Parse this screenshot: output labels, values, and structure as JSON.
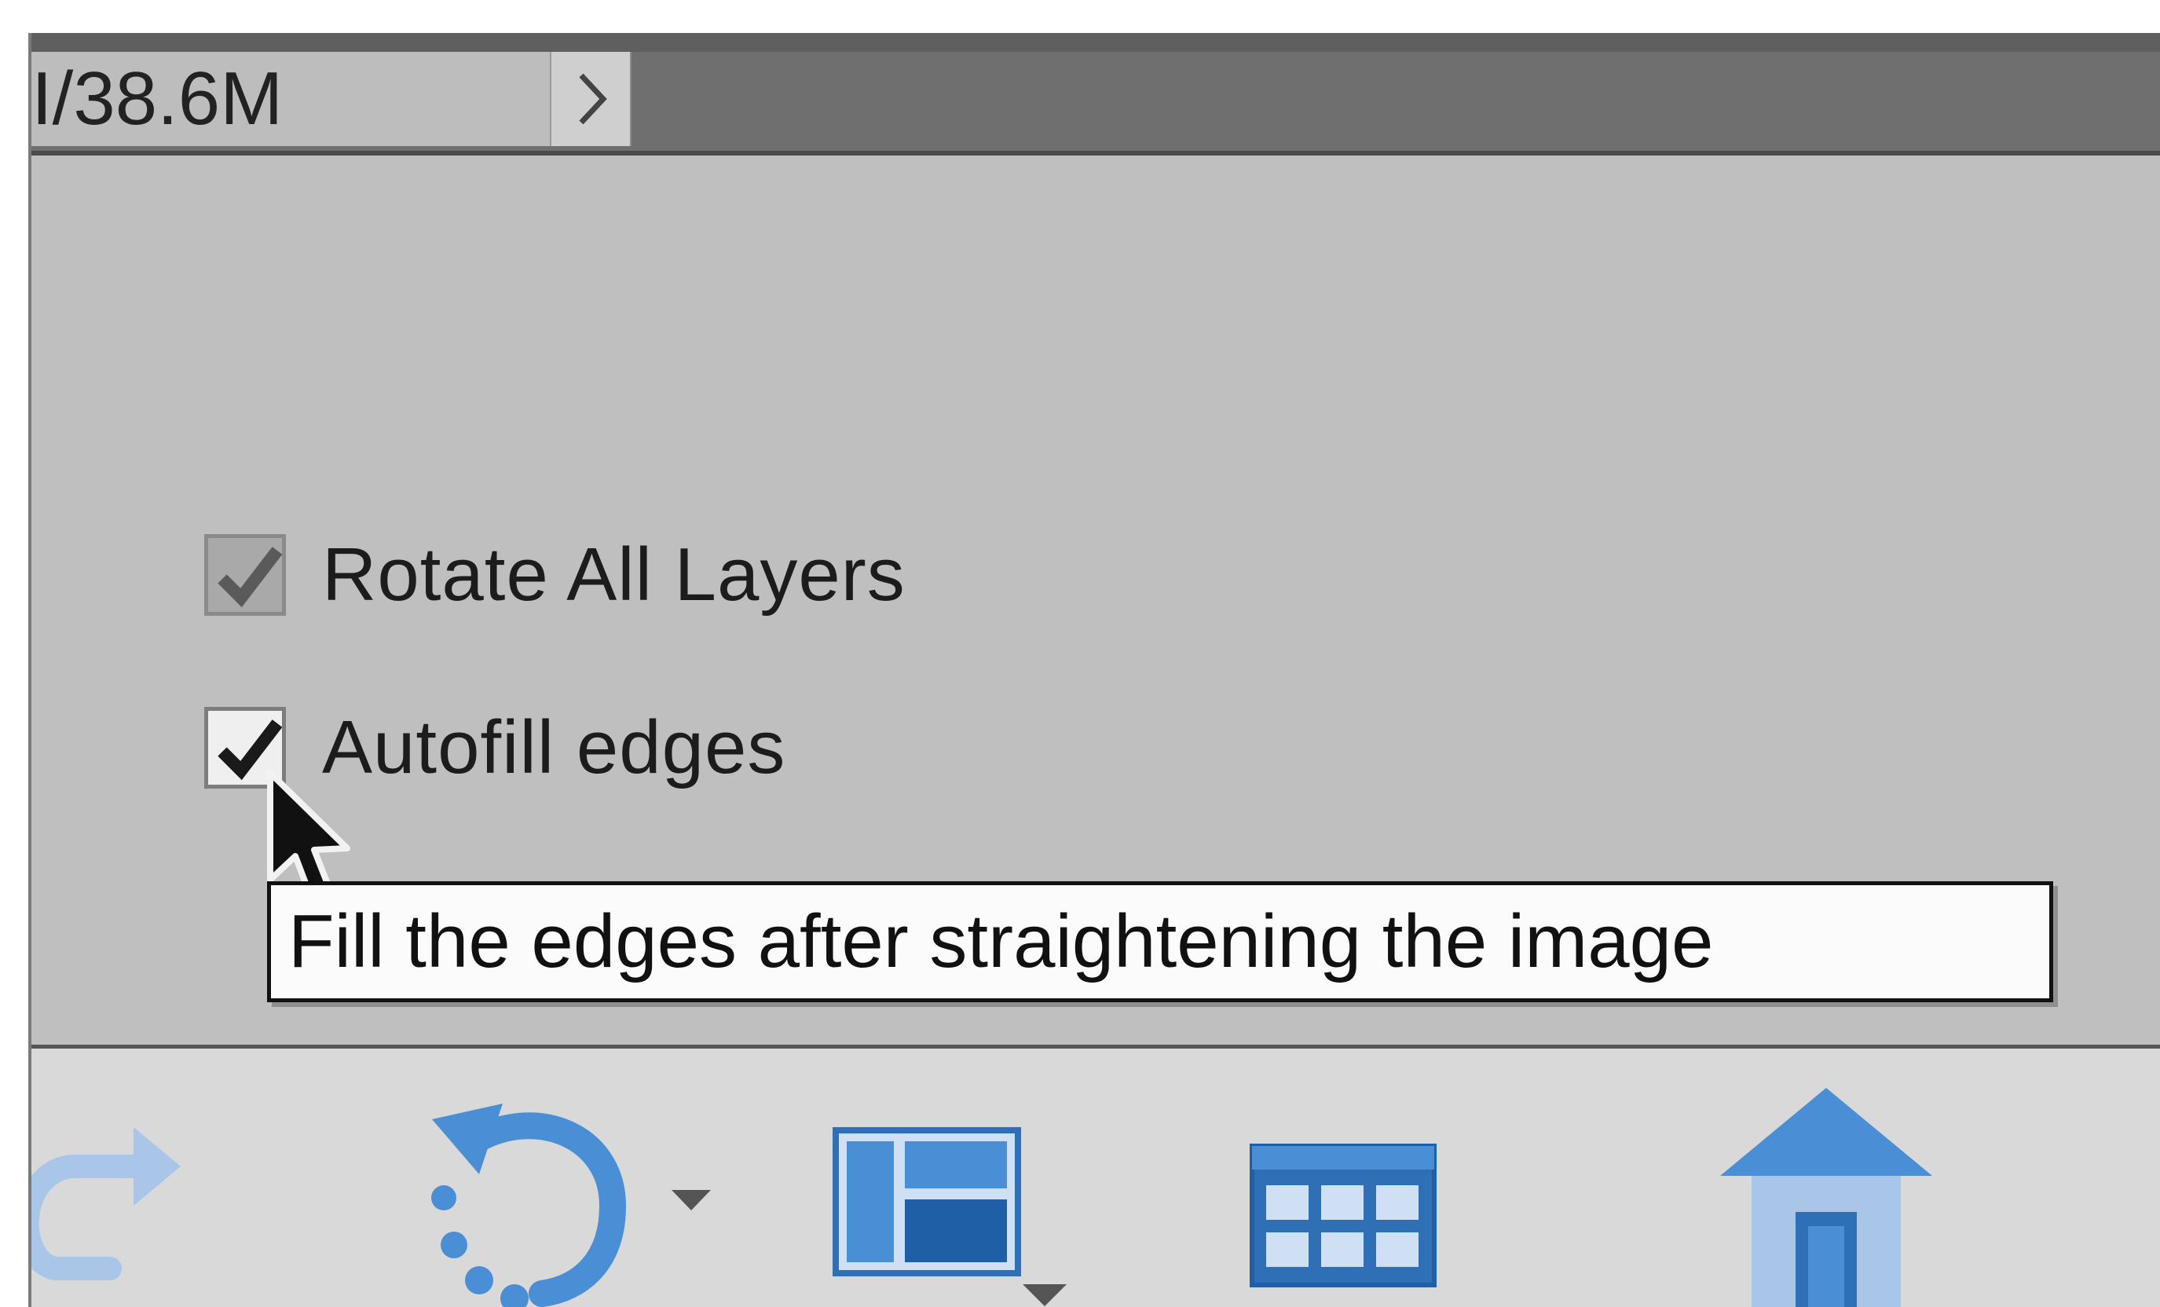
{
  "statusbar": {
    "document_size": "I/38.6M",
    "expand_icon": "chevron-right-icon"
  },
  "options": {
    "rotate_all_layers": {
      "label": "Rotate All Layers",
      "checked": true,
      "enabled": false
    },
    "autofill_edges": {
      "label": "Autofill edges",
      "checked": true,
      "enabled": true
    }
  },
  "tooltip": {
    "text": "Fill the edges after straightening the image"
  },
  "toolbar": {
    "items": [
      {
        "name": "redo-icon"
      },
      {
        "name": "rotate-icon",
        "has_dropdown": true
      },
      {
        "name": "layout-icon",
        "has_dropdown": true
      },
      {
        "name": "organizer-grid-icon"
      },
      {
        "name": "home-icon"
      }
    ]
  },
  "colors": {
    "panel_bg": "#bfbfbf",
    "statusbar_bg": "#6f6f6f",
    "toolbar_bg": "#d9d9d9",
    "icon_blue": "#4a8fd6",
    "icon_blue_dark": "#1f5fa6"
  }
}
